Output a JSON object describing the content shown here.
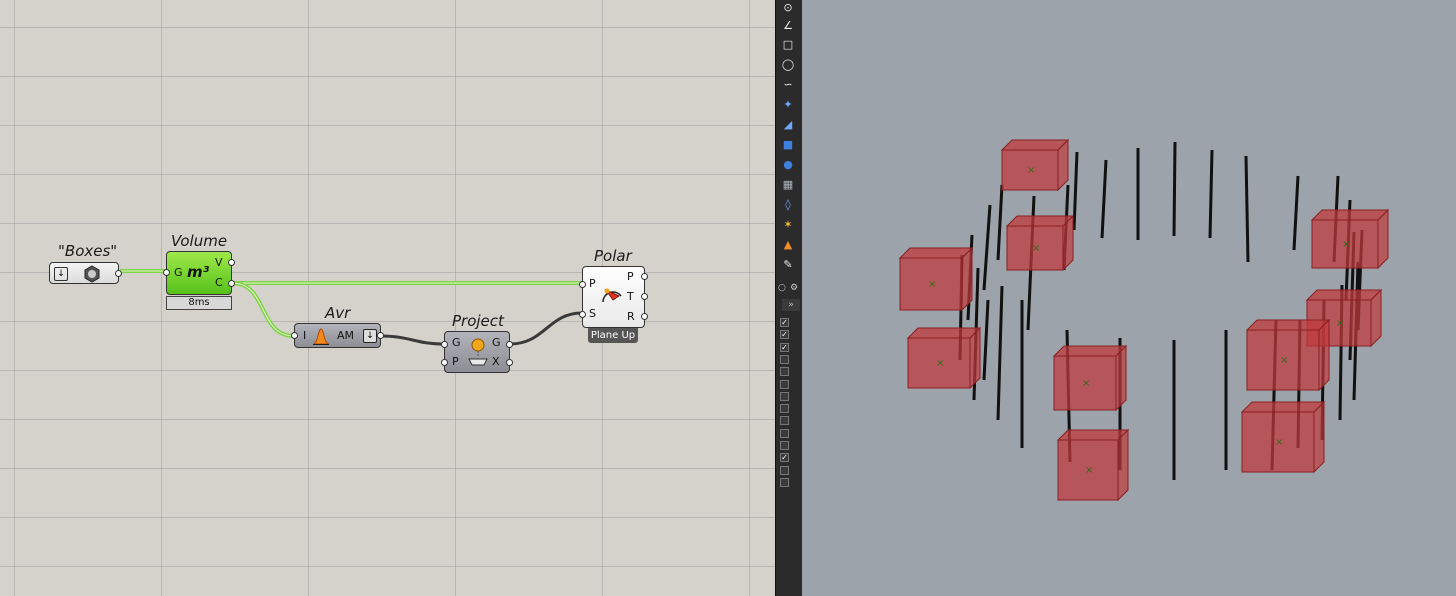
{
  "canvas": {
    "components": {
      "boxes": {
        "title": "\"Boxes\""
      },
      "volume": {
        "title": "Volume",
        "inputs": [
          "G"
        ],
        "outputs": [
          "V",
          "C"
        ],
        "icon_text": "m³",
        "timing": "8ms"
      },
      "avr": {
        "title": "Avr",
        "input": "I",
        "output": "AM"
      },
      "project": {
        "title": "Project",
        "inputs": [
          "G",
          "P"
        ],
        "outputs": [
          "G",
          "X"
        ]
      },
      "polar": {
        "title": "Polar",
        "inputs": [
          "P",
          "S"
        ],
        "outputs": [
          "P",
          "T",
          "R"
        ],
        "badge": "Plane Up"
      }
    },
    "colors": {
      "canvas_bg": "#d5d2cc",
      "selected_wire": "#7fd24a",
      "wire": "#3a3a3a"
    }
  },
  "toolbar": {
    "icons": [
      "point-icon",
      "polyline-icon",
      "rectangle-icon",
      "circle-icon",
      "curve-icon",
      "rebuild-icon",
      "surface-icon",
      "box-icon",
      "sphere-icon",
      "mesh-icon",
      "transform-icon",
      "analysis-icon",
      "render-icon",
      "grasshopper-icon"
    ],
    "panel_toggle": "»",
    "checkboxes": [
      true,
      true,
      true,
      false,
      false,
      false,
      false,
      false,
      false,
      false,
      false,
      true,
      false,
      false
    ]
  },
  "viewport": {
    "background": "#9da3aa",
    "box_color": "#c0393c",
    "line_color": "#111111"
  }
}
